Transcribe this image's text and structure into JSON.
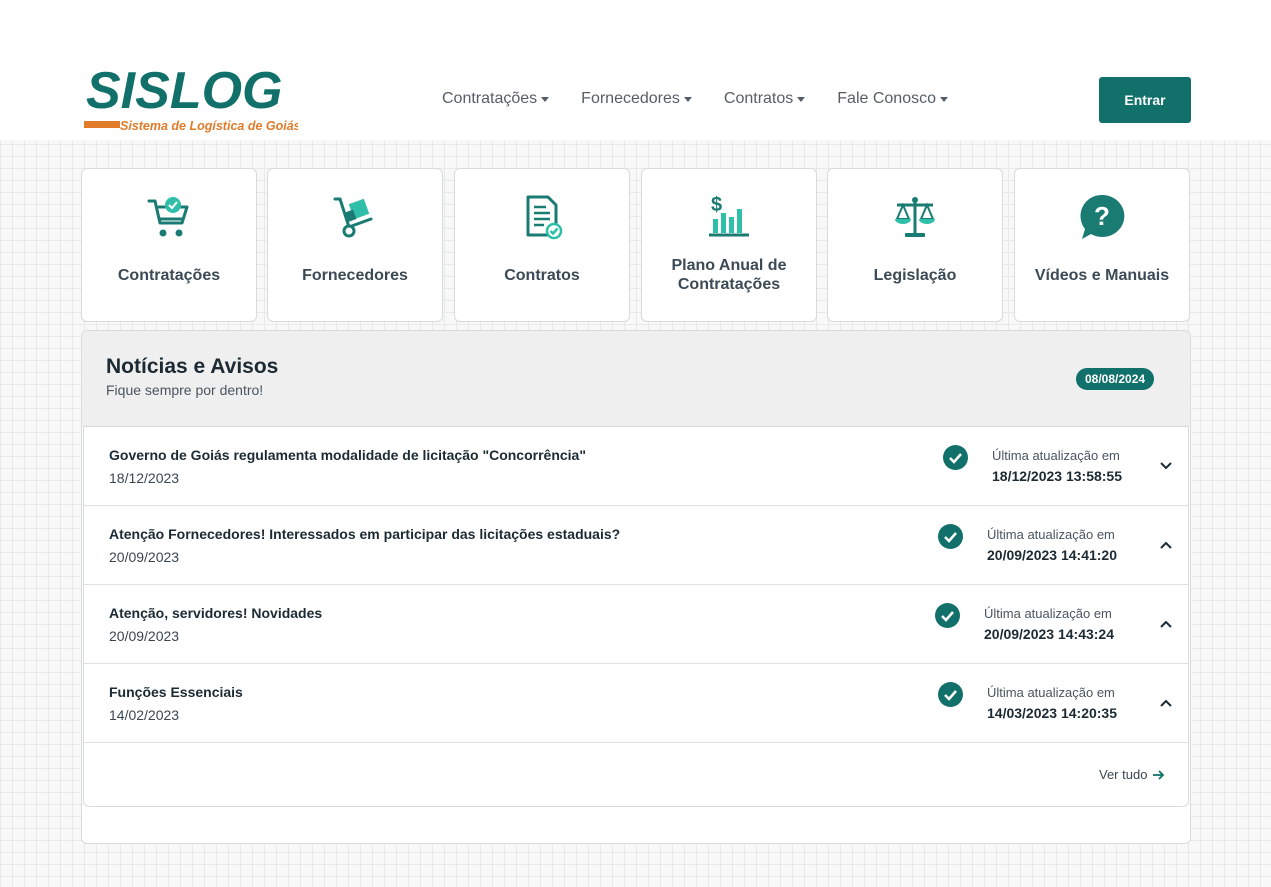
{
  "brand": {
    "logo_text": "SISLOG",
    "tagline": "Sistema de Logística de Goiás"
  },
  "nav": {
    "items": [
      {
        "label": "Contratações"
      },
      {
        "label": "Fornecedores"
      },
      {
        "label": "Contratos"
      },
      {
        "label": "Fale Conosco"
      }
    ],
    "login_label": "Entrar"
  },
  "cards": [
    {
      "label": "Contratações",
      "icon": "shopping-cart-check-icon"
    },
    {
      "label": "Fornecedores",
      "icon": "hand-truck-icon"
    },
    {
      "label": "Contratos",
      "icon": "document-check-icon"
    },
    {
      "label": "Plano Anual de Contratações",
      "icon": "dollar-bar-chart-icon"
    },
    {
      "label": "Legislação",
      "icon": "scales-icon"
    },
    {
      "label": "Vídeos e Manuais",
      "icon": "question-bubble-icon"
    }
  ],
  "news": {
    "title": "Notícias e Avisos",
    "subtitle": "Fique sempre por dentro!",
    "date_badge": "08/08/2024",
    "items": [
      {
        "title": "Governo de Goiás regulamenta modalidade de licitação \"Concorrência\"",
        "date": "18/12/2023",
        "updated_label": "Última atualização em",
        "updated_at": "18/12/2023 13:58:55",
        "expanded": false
      },
      {
        "title": "Atenção Fornecedores! Interessados em participar das licitações estaduais?",
        "date": "20/09/2023",
        "updated_label": "Última atualização em",
        "updated_at": "20/09/2023 14:41:20",
        "expanded": true
      },
      {
        "title": "Atenção, servidores! Novidades",
        "date": "20/09/2023",
        "updated_label": "Última atualização em",
        "updated_at": "20/09/2023 14:43:24",
        "expanded": true
      },
      {
        "title": "Funções Essenciais",
        "date": "14/02/2023",
        "updated_label": "Última atualização em",
        "updated_at": "14/03/2023 14:20:35",
        "expanded": true
      }
    ],
    "see_all_label": "Ver tudo"
  },
  "colors": {
    "primary": "#12706a",
    "icon_teal": "#1a7b73",
    "icon_accent": "#2fbfa8",
    "logo_orange": "#e07b2a"
  }
}
